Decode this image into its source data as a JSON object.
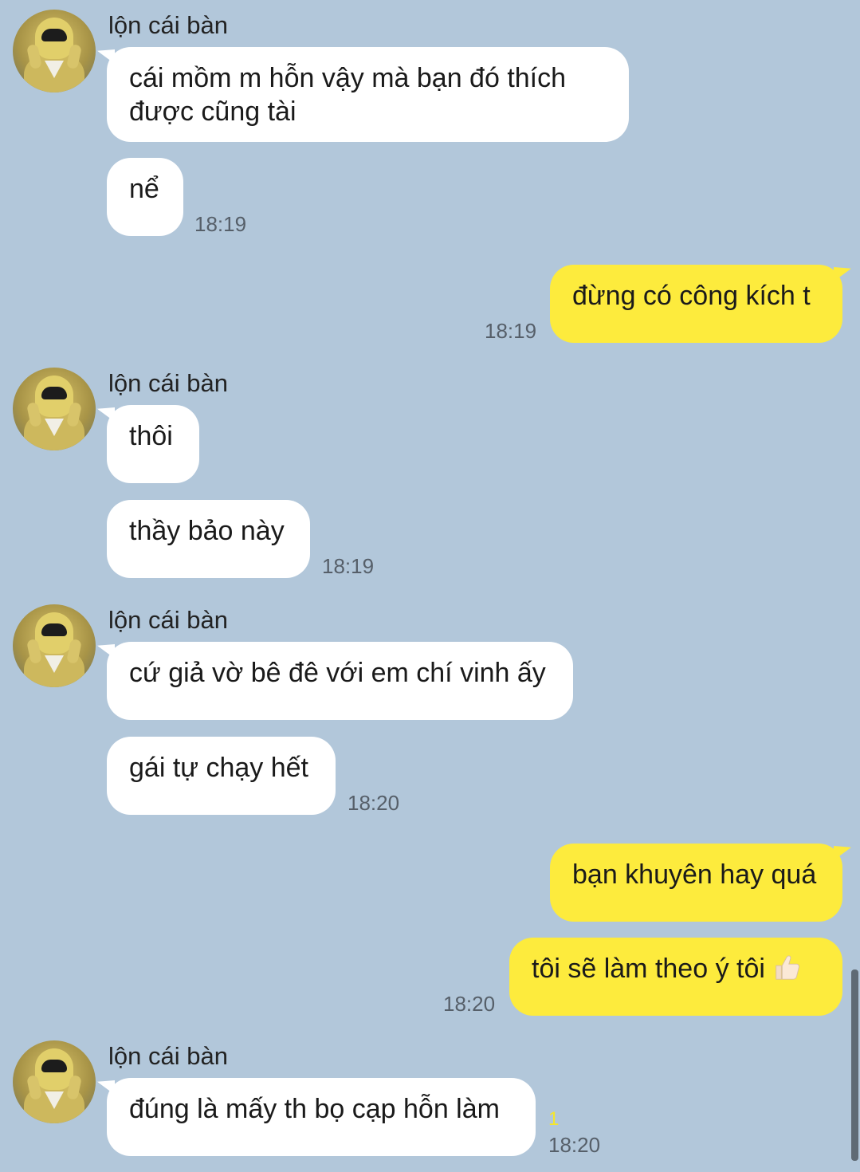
{
  "conversation": {
    "sender_name": "lộn cái bàn",
    "messages": [
      {
        "from": "other",
        "text_lines": [
          "cái mồm m hỗn vậy mà bạn đó thích",
          "được cũng tài"
        ]
      },
      {
        "from": "other",
        "text": "nể",
        "time": "18:19"
      },
      {
        "from": "me",
        "text": "đừng có công kích t",
        "time": "18:19"
      },
      {
        "from": "other",
        "text": "thôi"
      },
      {
        "from": "other",
        "text": "thầy bảo này",
        "time": "18:19"
      },
      {
        "from": "other",
        "text": "cứ giả vờ bê đê với em chí vinh ấy"
      },
      {
        "from": "other",
        "text": "gái tự chạy hết",
        "time": "18:20"
      },
      {
        "from": "me",
        "text": "bạn khuyên hay quá"
      },
      {
        "from": "me",
        "text": "tôi sẽ làm theo ý tôi",
        "emoji": "thumbs-up",
        "time": "18:20"
      },
      {
        "from": "other",
        "text": "đúng là mấy th bọ cạp hỗn làm",
        "unread": "1",
        "time": "18:20"
      }
    ]
  },
  "colors": {
    "background": "#b2c7da",
    "my_bubble": "#fdeb3d",
    "their_bubble": "#ffffff",
    "unread": "#f5e62a"
  }
}
